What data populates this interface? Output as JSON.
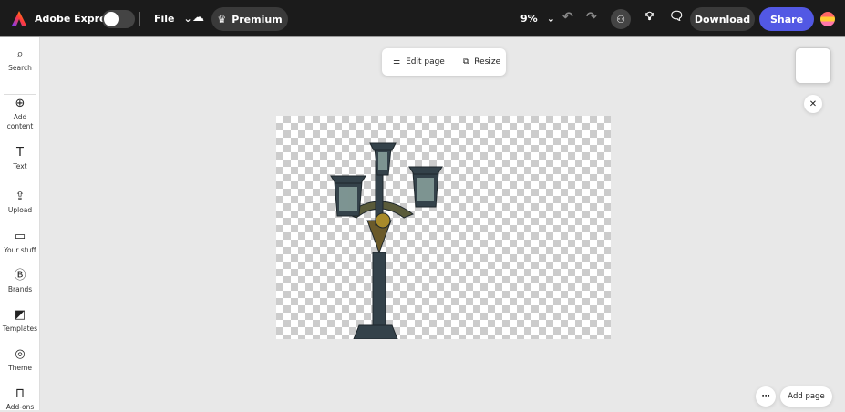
{
  "app": {
    "title": "Adobe Express",
    "file_label": "File",
    "premium_label": "Premium",
    "zoom": "9%",
    "download_label": "Download",
    "share_label": "Share",
    "accent": "#5258e4"
  },
  "sidebar": {
    "items": [
      {
        "label": "Search",
        "icon": "search-icon",
        "glyph": "⌕"
      },
      {
        "label": "Add content",
        "icon": "plus-circle-icon",
        "glyph": "⊕"
      },
      {
        "label": "Text",
        "icon": "text-icon",
        "glyph": "T"
      },
      {
        "label": "Upload",
        "icon": "upload-icon",
        "glyph": "⇪"
      },
      {
        "label": "Your stuff",
        "icon": "folder-icon",
        "glyph": "▭"
      },
      {
        "label": "Brands",
        "icon": "brand-icon",
        "glyph": "Ⓑ"
      },
      {
        "label": "Templates",
        "icon": "templates-icon",
        "glyph": "◩"
      },
      {
        "label": "Theme",
        "icon": "palette-icon",
        "glyph": "◎"
      },
      {
        "label": "Add-ons",
        "icon": "addons-icon",
        "glyph": "⊓"
      }
    ]
  },
  "toolbar": {
    "edit_page": "Edit page",
    "resize": "Resize"
  },
  "footer": {
    "add_page": "Add page"
  }
}
